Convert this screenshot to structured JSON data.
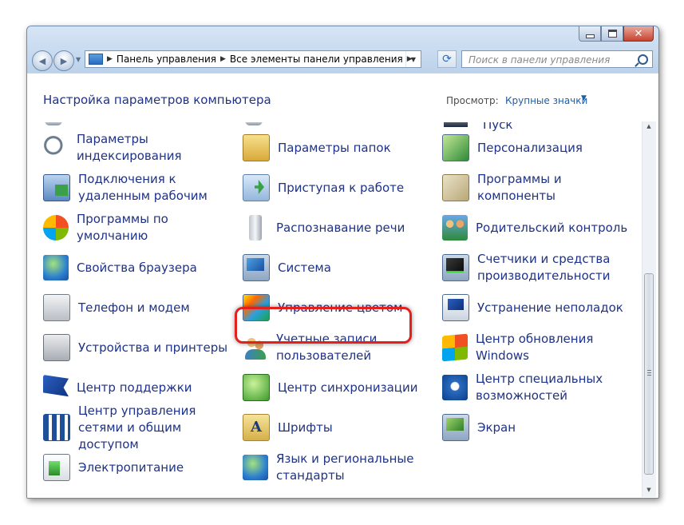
{
  "toolbar": {
    "breadcrumbs": [
      "Панель управления",
      "Все элементы панели управления"
    ],
    "search_placeholder": "Поиск в панели управления"
  },
  "header": {
    "title": "Настройка параметров компьютера",
    "view_label": "Просмотр:",
    "view_value": "Крупные значки"
  },
  "top_partial_label": "Пуск",
  "items": [
    {
      "label": "Параметры индексирования",
      "icon": "indexing-options-icon"
    },
    {
      "label": "Параметры папок",
      "icon": "folder-options-icon"
    },
    {
      "label": "Персонализация",
      "icon": "personalization-icon"
    },
    {
      "label": "Подключения к удаленным рабочим",
      "icon": "remote-desktop-icon"
    },
    {
      "label": "Приступая к работе",
      "icon": "getting-started-icon"
    },
    {
      "label": "Программы и компоненты",
      "icon": "programs-features-icon"
    },
    {
      "label": "Программы по умолчанию",
      "icon": "default-programs-icon"
    },
    {
      "label": "Распознавание речи",
      "icon": "microphone-icon"
    },
    {
      "label": "Родительский контроль",
      "icon": "parental-controls-icon"
    },
    {
      "label": "Свойства браузера",
      "icon": "internet-options-icon"
    },
    {
      "label": "Система",
      "icon": "system-icon"
    },
    {
      "label": "Счетчики и средства производительности",
      "icon": "performance-icon"
    },
    {
      "label": "Телефон и модем",
      "icon": "phone-modem-icon"
    },
    {
      "label": "Управление цветом",
      "icon": "color-management-icon"
    },
    {
      "label": "Устранение неполадок",
      "icon": "troubleshooting-icon"
    },
    {
      "label": "Устройства и принтеры",
      "icon": "printer-icon"
    },
    {
      "label": "Учетные записи пользователей",
      "icon": "user-accounts-icon"
    },
    {
      "label": "Центр обновления Windows",
      "icon": "windows-update-icon"
    },
    {
      "label": "Центр поддержки",
      "icon": "action-center-flag-icon"
    },
    {
      "label": "Центр синхронизации",
      "icon": "sync-center-icon"
    },
    {
      "label": "Центр специальных возможностей",
      "icon": "ease-of-access-icon"
    },
    {
      "label": "Центр управления сетями и общим доступом",
      "icon": "network-center-icon"
    },
    {
      "label": "Шрифты",
      "icon": "fonts-icon"
    },
    {
      "label": "Экран",
      "icon": "display-icon"
    },
    {
      "label": "Электропитание",
      "icon": "power-options-icon"
    },
    {
      "label": "Язык и региональные стандарты",
      "icon": "region-language-icon"
    }
  ],
  "highlighted_item": "Система",
  "colors": {
    "link": "#1e3287",
    "highlight_border": "#e3201b",
    "window_frame": "#c3d7ec"
  }
}
